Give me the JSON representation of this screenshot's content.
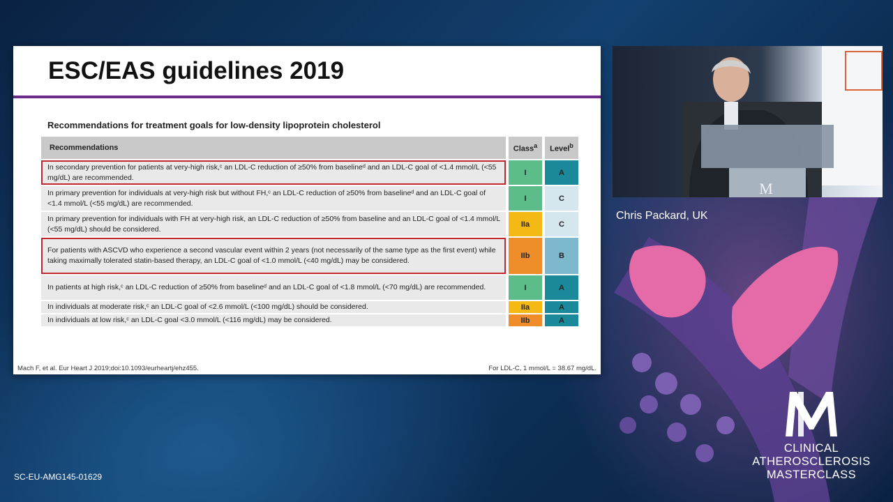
{
  "slide": {
    "title": "ESC/EAS guidelines 2019",
    "table_caption": "Recommendations for treatment goals for low-density lipoprotein cholesterol",
    "columns": {
      "recommendation": "Recommendations",
      "class": "Class",
      "class_sup": "a",
      "level": "Level",
      "level_sup": "b"
    },
    "rows": [
      {
        "text": "In secondary prevention for patients at very-high risk,ᶜ an LDL-C reduction of ≥50% from baselineᵈ and an LDL-C goal of <1.4 mmol/L (<55 mg/dL) are recommended.",
        "class": "I",
        "level": "A"
      },
      {
        "text": "In primary prevention for individuals at very-high risk but without FH,ᶜ an LDL-C reduction of ≥50% from baselineᵈ and an LDL-C goal of <1.4 mmol/L (<55 mg/dL) are recommended.",
        "class": "I",
        "level": "C"
      },
      {
        "text": "In primary prevention for individuals with FH at very-high risk, an LDL-C reduction of ≥50% from baseline and an LDL-C goal of <1.4 mmol/L (<55 mg/dL) should be considered.",
        "class": "IIa",
        "level": "C"
      },
      {
        "text": "For patients with ASCVD who experience a second vascular event within 2 years (not necessarily of the same type as the first event) while taking maximally tolerated statin-based therapy, an LDL-C goal of <1.0 mmol/L (<40 mg/dL) may be considered.",
        "class": "IIb",
        "level": "B"
      },
      {
        "text": "In patients at high risk,ᶜ an LDL-C reduction of ≥50% from baselineᵈ and an LDL-C goal of <1.8 mmol/L (<70 mg/dL) are recommended.",
        "class": "I",
        "level": "A"
      },
      {
        "text": "In individuals at moderate risk,ᶜ an LDL-C goal of <2.6 mmol/L (<100 mg/dL) should be considered.",
        "class": "IIa",
        "level": "A"
      },
      {
        "text": "In individuals at low risk,ᶜ an LDL-C goal <3.0 mmol/L (<116 mg/dL) may be considered.",
        "class": "IIb",
        "level": "A"
      }
    ],
    "footnote_left": "Mach F, et al. Eur Heart J 2019;doi:10.1093/eurheartj/ehz455.",
    "footnote_right": "For LDL-C, 1 mmol/L = 38.67 mg/dL."
  },
  "speaker": {
    "name": "Chris Packard, UK"
  },
  "logo": {
    "letter": "M",
    "line1": "CLINICAL",
    "line2": "ATHEROSCLEROSIS",
    "line3": "MASTERCLASS"
  },
  "code": "SC-EU-AMG145-01629",
  "colors": {
    "accent_rule": "#6b2c87",
    "outline_red": "#c0272d",
    "class_I": "#5dbd8a",
    "class_IIa": "#f5b915",
    "class_IIb": "#ef8d2b",
    "level_A": "#1a8a9a",
    "level_B": "#7db8cc",
    "level_C": "#d6e6ee"
  }
}
